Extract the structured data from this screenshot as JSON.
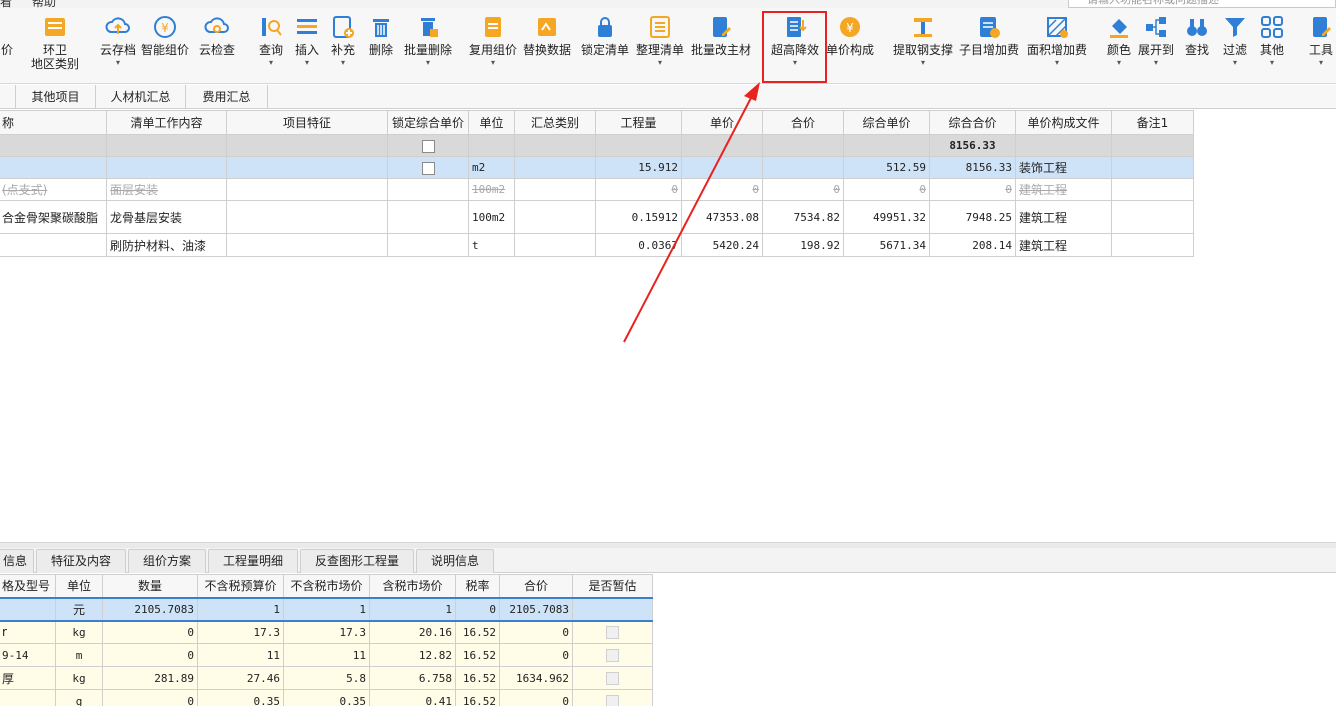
{
  "menu": {
    "help": "帮助"
  },
  "search": {
    "placeholder": "请输入功能名称或问题描述"
  },
  "toolbar": {
    "price_tail": "价",
    "hw_line1": "环卫",
    "hw_line2": "地区类别",
    "cloud_archive": "云存档",
    "smart_price": "智能组价",
    "cloud_check": "云检查",
    "query": "查询",
    "insert": "插入",
    "supplement": "补充",
    "delete": "删除",
    "batch_delete": "批量删除",
    "reuse_price": "复用组价",
    "replace_data": "替换数据",
    "lock_list": "锁定清单",
    "organize_list": "整理清单",
    "batch_main_material": "批量改主材",
    "super_height": "超高降效",
    "unit_price_comp": "单价构成",
    "extract_steel": "提取钢支撑",
    "sub_fee": "子目增加费",
    "area_fee": "面积增加费",
    "color": "颜色",
    "expand_to": "展开到",
    "find": "查找",
    "filter": "过滤",
    "other": "其他",
    "tools": "工具"
  },
  "tabs": [
    "其他项目",
    "人材机汇总",
    "费用汇总"
  ],
  "main_table": {
    "headers": [
      "称",
      "清单工作内容",
      "项目特征",
      "锁定综合单价",
      "单位",
      "汇总类别",
      "工程量",
      "单价",
      "合价",
      "综合单价",
      "综合合价",
      "单价构成文件",
      "备注1"
    ],
    "sum_row": {
      "total": "8156.33"
    },
    "sel_row": {
      "unit": "m2",
      "qty": "15.912",
      "comp_price": "512.59",
      "comp_total": "8156.33",
      "file": "装饰工程"
    },
    "del_row": {
      "name": "(点支式)",
      "work": "面层安装",
      "unit": "100m2",
      "qty": "0",
      "price": "0",
      "total": "0",
      "comp_price": "0",
      "comp_total": "0",
      "file": "建筑工程"
    },
    "row3": {
      "name": "合金骨架聚碳酸脂",
      "work": "龙骨基层安装",
      "unit": "100m2",
      "qty": "0.15912",
      "price": "47353.08",
      "total": "7534.82",
      "comp_price": "49951.32",
      "comp_total": "7948.25",
      "file": "建筑工程"
    },
    "row4": {
      "name": "",
      "work": "刷防护材料、油漆",
      "unit": "t",
      "qty": "0.0367",
      "price": "5420.24",
      "total": "198.92",
      "comp_price": "5671.34",
      "comp_total": "208.14",
      "file": "建筑工程"
    }
  },
  "bottom_tabs": [
    "信息",
    "特征及内容",
    "组价方案",
    "工程量明细",
    "反查图形工程量",
    "说明信息"
  ],
  "bottom_table": {
    "headers": [
      "格及型号",
      "单位",
      "数量",
      "不含税预算价",
      "不含税市场价",
      "含税市场价",
      "税率",
      "合价",
      "是否暂估"
    ],
    "rows": [
      {
        "spec": "",
        "unit": "元",
        "qty": "2105.7083",
        "budget": "1",
        "market": "1",
        "market_tax": "1",
        "rate": "0",
        "total": "2105.7083"
      },
      {
        "spec": "r",
        "unit": "kg",
        "qty": "0",
        "budget": "17.3",
        "market": "17.3",
        "market_tax": "20.16",
        "rate": "16.52",
        "total": "0"
      },
      {
        "spec": "9-14",
        "unit": "m",
        "qty": "0",
        "budget": "11",
        "market": "11",
        "market_tax": "12.82",
        "rate": "16.52",
        "total": "0"
      },
      {
        "spec": "厚",
        "unit": "kg",
        "qty": "281.89",
        "budget": "27.46",
        "market": "5.8",
        "market_tax": "6.758",
        "rate": "16.52",
        "total": "1634.962"
      },
      {
        "spec": "",
        "unit": "g",
        "qty": "0",
        "budget": "0.35",
        "market": "0.35",
        "market_tax": "0.41",
        "rate": "16.52",
        "total": "0"
      }
    ]
  },
  "colors": {
    "accent_orange": "#f5a623",
    "accent_blue": "#2f7fd6",
    "highlight_red": "#e8221e",
    "selection": "#cfe3f8"
  }
}
